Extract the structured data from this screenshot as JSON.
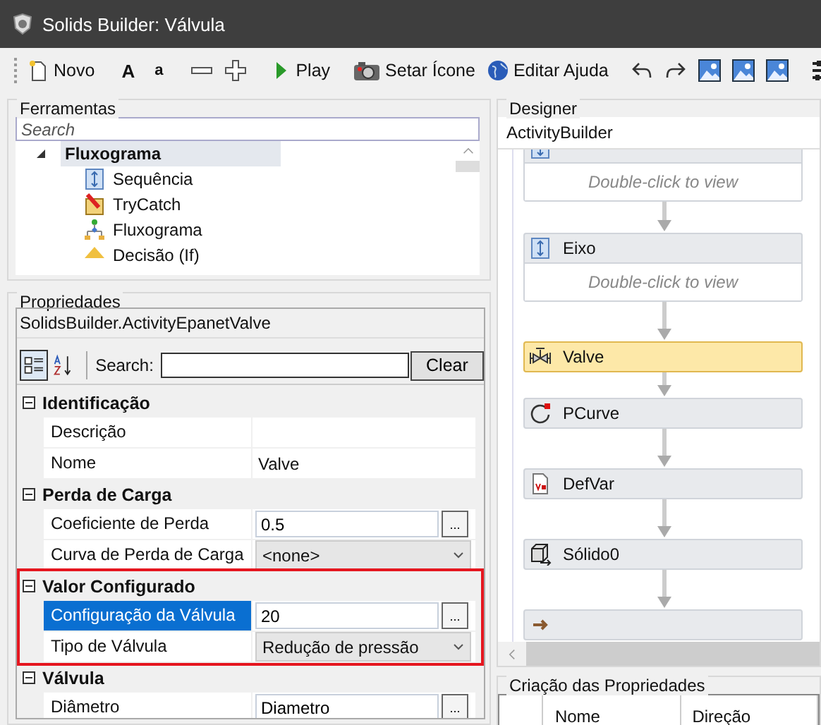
{
  "window": {
    "title": "Solids Builder: Válvula"
  },
  "toolbar": [
    {
      "kind": "new",
      "label": "Novo"
    },
    {
      "kind": "sep"
    },
    {
      "kind": "bigfont",
      "label": "A"
    },
    {
      "kind": "smallfont",
      "label": "a"
    },
    {
      "kind": "sep"
    },
    {
      "kind": "minus"
    },
    {
      "kind": "plus"
    },
    {
      "kind": "sep"
    },
    {
      "kind": "play",
      "label": "Play"
    },
    {
      "kind": "sep"
    },
    {
      "kind": "camera",
      "label": "Setar Ícone"
    },
    {
      "kind": "globe",
      "label": "Editar Ajuda"
    },
    {
      "kind": "sep"
    },
    {
      "kind": "undo"
    },
    {
      "kind": "redo"
    },
    {
      "kind": "image"
    },
    {
      "kind": "image"
    },
    {
      "kind": "image"
    },
    {
      "kind": "sep"
    },
    {
      "kind": "sliders"
    }
  ],
  "tools": {
    "title": "Ferramentas",
    "search": {
      "placeholder": "Search"
    },
    "tree": [
      {
        "label": "Fluxograma",
        "expanded": true,
        "selected": true,
        "children": [
          {
            "label": "Sequência",
            "kind": "sequence",
            "selected": false
          },
          {
            "label": "TryCatch",
            "kind": "trycatch",
            "selected": false
          },
          {
            "label": "Fluxograma",
            "kind": "flowchart",
            "selected": false
          },
          {
            "label": "Decisão (If)",
            "kind": "decision",
            "selected": false
          }
        ]
      }
    ]
  },
  "properties": {
    "title": "Propriedades",
    "object": "SolidsBuilder.ActivityEpanetValve",
    "categorized": true,
    "search_label": "Search:",
    "clear": "Clear",
    "categories": [
      {
        "name": "Identificação",
        "expanded": true,
        "rows": [
          {
            "label": "Descrição",
            "kind": "text",
            "selected": false
          },
          {
            "label": "Nome",
            "value": "Valve",
            "kind": "text",
            "selected": false
          }
        ]
      },
      {
        "name": "Perda de Carga",
        "expanded": true,
        "rows": [
          {
            "label": "Coeficiente de Perda",
            "value": "0.5",
            "kind": "textbox",
            "button": "...",
            "selected": false
          },
          {
            "label": "Curva de Perda de Carga",
            "value": "<none>",
            "kind": "dropdown",
            "selected": false
          }
        ]
      },
      {
        "name": "Valor Configurado",
        "expanded": true,
        "highlighted": true,
        "rows": [
          {
            "label": "Configuração da Válvula",
            "value": "20",
            "kind": "textbox",
            "button": "...",
            "selected": true
          },
          {
            "label": "Tipo de Válvula",
            "value": "Redução de pressão",
            "kind": "dropdown",
            "selected": false
          }
        ]
      },
      {
        "name": "Válvula",
        "expanded": true,
        "rows": [
          {
            "label": "Diâmetro",
            "value": "Diametro",
            "kind": "textbox",
            "button": "...",
            "selected": false
          }
        ]
      }
    ]
  },
  "designer": {
    "title": "Designer",
    "breadcrumb": "ActivityBuilder",
    "nodes": [
      {
        "kind": "sequence",
        "body": "Double-click to view",
        "selected": false
      },
      {
        "kind": "sequence",
        "label": "Eixo",
        "body": "Double-click to view",
        "selected": false
      },
      {
        "kind": "valve",
        "label": "Valve",
        "selected": true
      },
      {
        "kind": "curve",
        "label": "PCurve",
        "selected": false
      },
      {
        "kind": "variable",
        "label": "DefVar",
        "selected": false
      },
      {
        "kind": "solid",
        "label": "Sólido0",
        "selected": false
      },
      {
        "kind": "text",
        "selected": false
      }
    ]
  },
  "property_creation": {
    "title": "Criação das Propriedades",
    "columns": [
      "Nome",
      "Direção"
    ]
  }
}
